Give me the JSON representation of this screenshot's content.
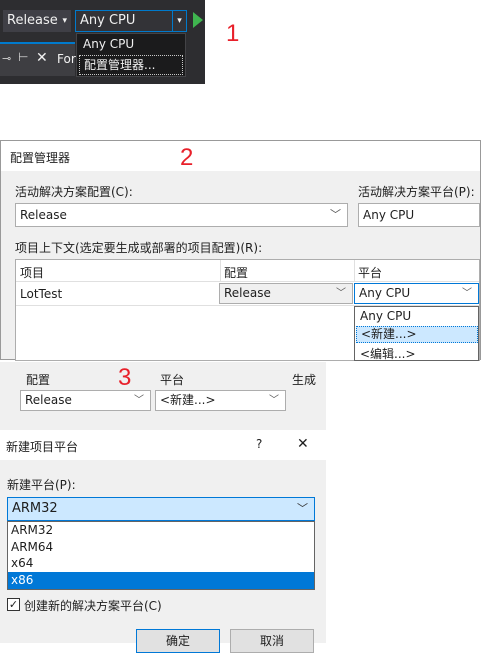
{
  "step_labels": [
    "1",
    "2",
    "3"
  ],
  "toolbar": {
    "config_value": "Release",
    "platform_value": "Any CPU",
    "dropdown_items": [
      "Any CPU",
      "配置管理器..."
    ],
    "tab_partial": "For"
  },
  "config_manager": {
    "title": "配置管理器",
    "active_config_label": "活动解决方案配置(C):",
    "active_config_value": "Release",
    "active_platform_label": "活动解决方案平台(P):",
    "active_platform_value": "Any CPU",
    "context_label": "项目上下文(选定要生成或部署的项目配置)(R):",
    "columns": [
      "项目",
      "配置",
      "平台"
    ],
    "row": {
      "project": "LotTest",
      "config": "Release",
      "platform": "Any CPU"
    },
    "platform_options": [
      "Any CPU",
      "<新建...>",
      "<编辑...>"
    ]
  },
  "strip": {
    "columns": [
      "配置",
      "平台",
      "生成"
    ],
    "config_value": "Release",
    "platform_value": "<新建...>"
  },
  "new_platform_dialog": {
    "title": "新建项目平台",
    "help": "?",
    "close": "✕",
    "new_platform_label": "新建平台(P):",
    "selected": "ARM32",
    "options": [
      "ARM32",
      "ARM64",
      "x64",
      "x86"
    ],
    "checkbox_label": "创建新的解决方案平台(C)",
    "ok": "确定",
    "cancel": "取消"
  },
  "colors": {
    "accent": "#0078d7",
    "step": "#e8202a",
    "selected_bg": "#cce8ff"
  }
}
